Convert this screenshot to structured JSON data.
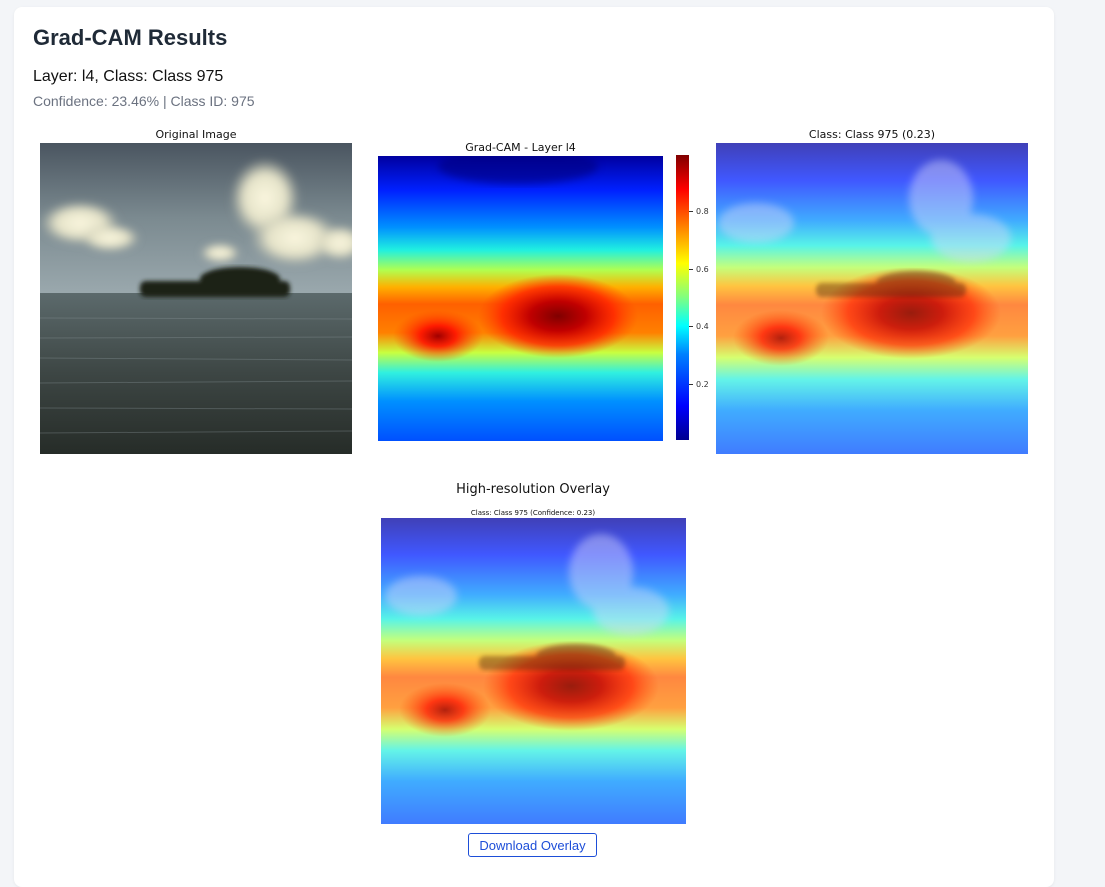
{
  "header": {
    "title": "Grad-CAM Results",
    "subtitle": "Layer: l4, Class: Class 975",
    "meta": "Confidence: 23.46% | Class ID: 975"
  },
  "figure": {
    "original_title": "Original Image",
    "gradcam_title": "Grad-CAM - Layer l4",
    "overlay_title": "Class: Class 975 (0.23)",
    "colorbar_ticks": [
      "0.8",
      "0.6",
      "0.4",
      "0.2"
    ],
    "colorbar_colormap": "jet"
  },
  "hires": {
    "heading": "High-resolution Overlay",
    "title": "Class: Class 975 (Confidence: 0.23)"
  },
  "actions": {
    "download_label": "Download Overlay"
  },
  "colors": {
    "accent": "#1d4ed8",
    "title": "#1f2a37",
    "muted": "#6b7280"
  }
}
